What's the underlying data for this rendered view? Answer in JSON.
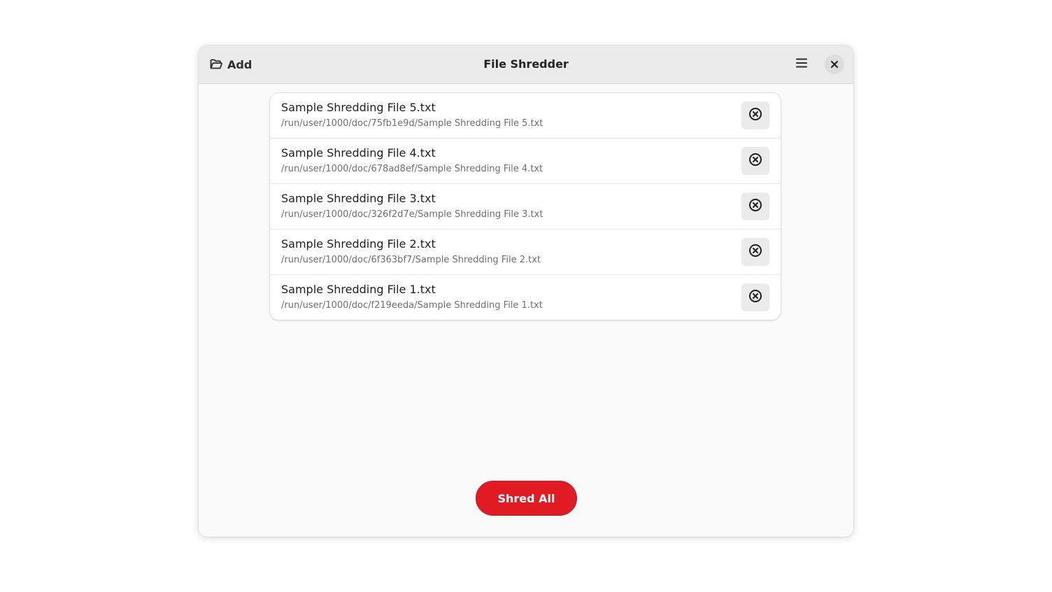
{
  "window": {
    "title": "File Shredder"
  },
  "header": {
    "add_label": "Add",
    "add_icon": "folder-open-icon",
    "menu_icon": "hamburger-menu-icon",
    "close_icon": "close-icon"
  },
  "files": [
    {
      "name": "Sample Shredding File 5.txt",
      "path": "/run/user/1000/doc/75fb1e9d/Sample Shredding File 5.txt"
    },
    {
      "name": "Sample Shredding File 4.txt",
      "path": "/run/user/1000/doc/678ad8ef/Sample Shredding File 4.txt"
    },
    {
      "name": "Sample Shredding File 3.txt",
      "path": "/run/user/1000/doc/326f2d7e/Sample Shredding File 3.txt"
    },
    {
      "name": "Sample Shredding File 2.txt",
      "path": "/run/user/1000/doc/6f363bf7/Sample Shredding File 2.txt"
    },
    {
      "name": "Sample Shredding File 1.txt",
      "path": "/run/user/1000/doc/f219eeda/Sample Shredding File 1.txt"
    }
  ],
  "actions": {
    "shred_all_label": "Shred All"
  },
  "colors": {
    "accent_destructive": "#e01b24",
    "headerbar": "#ebebeb",
    "window_bg": "#fafafa"
  }
}
